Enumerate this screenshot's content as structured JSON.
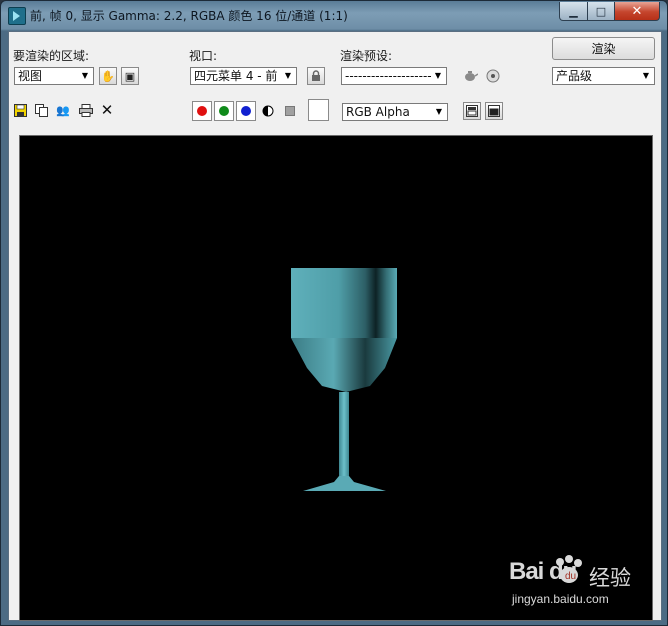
{
  "window": {
    "title": "前, 帧 0, 显示 Gamma: 2.2, RGBA 颜色 16 位/通道 (1:1)",
    "min_glyph": "▁",
    "max_glyph": "□",
    "close_glyph": "✕"
  },
  "toolbar": {
    "area_label": "要渲染的区域:",
    "area_value": "视图",
    "viewport_label": "视口:",
    "viewport_value": "四元菜单 4 - 前",
    "preset_label": "渲染预设:",
    "preset_value": "--------------------",
    "render_button": "渲染",
    "quality_value": "产品级",
    "channel_value": "RGB Alpha"
  },
  "colors": {
    "red": "#e01010",
    "green": "#0f8a1a",
    "blue": "#1020d0",
    "viewport_bg": "#000000",
    "goblet": "#4f9ea8"
  },
  "watermark": {
    "logo_text": "Bai  du",
    "cn_text": "经验",
    "url": "jingyan.baidu.com"
  }
}
